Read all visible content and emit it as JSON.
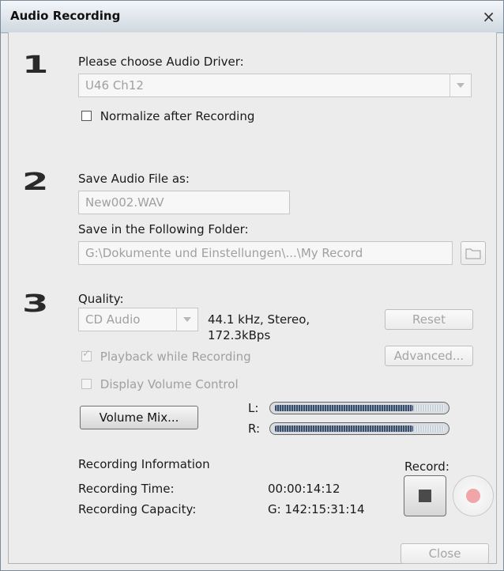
{
  "window": {
    "title": "Audio Recording",
    "close_glyph": "×"
  },
  "step1": {
    "number": "1",
    "driver_label": "Please choose Audio Driver:",
    "driver_value": "U46 Ch12",
    "normalize_label": "Normalize after Recording",
    "normalize_checked": false
  },
  "step2": {
    "number": "2",
    "save_as_label": "Save Audio File as:",
    "file_name": "New002.WAV",
    "folder_label": "Save in the Following Folder:",
    "folder_path": "G:\\Dokumente und Einstellungen\\...\\My Record"
  },
  "step3": {
    "number": "3",
    "quality_label": "Quality:",
    "quality_value": "CD Audio",
    "quality_info_line1": "44.1 kHz, Stereo,",
    "quality_info_line2": "172.3kBps",
    "reset_label": "Reset",
    "advanced_label": "Advanced...",
    "playback_label": "Playback while Recording",
    "playback_checked": true,
    "display_volume_label": "Display Volume Control",
    "display_volume_checked": false,
    "volume_mix_label": "Volume Mix...",
    "meter_left_label": "L:",
    "meter_right_label": "R:",
    "meter_left_level": 0.82,
    "meter_right_level": 0.82
  },
  "info": {
    "heading": "Recording Information",
    "time_label": "Recording Time:",
    "time_value": "00:00:14:12",
    "capacity_label": "Recording Capacity:",
    "capacity_value": "G: 142:15:31:14"
  },
  "record": {
    "label": "Record:"
  },
  "footer": {
    "close_label": "Close"
  }
}
